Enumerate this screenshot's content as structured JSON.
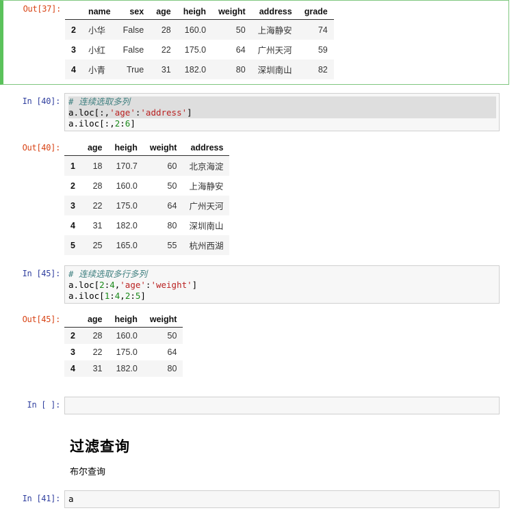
{
  "notebook": {
    "kernel_language": "python"
  },
  "cells": [
    {
      "id": "out37",
      "type": "output",
      "selected": true,
      "prompt": "Out[37]:",
      "table": {
        "index_name": "",
        "columns": [
          "name",
          "sex",
          "age",
          "heigh",
          "weight",
          "address",
          "grade"
        ],
        "index": [
          "2",
          "3",
          "4"
        ],
        "rows": [
          [
            "小华",
            "False",
            "28",
            "160.0",
            "50",
            "上海静安",
            "74"
          ],
          [
            "小红",
            "False",
            "22",
            "175.0",
            "64",
            "广州天河",
            "59"
          ],
          [
            "小青",
            "True",
            "31",
            "182.0",
            "80",
            "深圳南山",
            "82"
          ]
        ],
        "text_columns": [
          0,
          5
        ]
      }
    },
    {
      "id": "in40",
      "type": "input",
      "prompt": "In [40]:",
      "lines": [
        {
          "selected": true,
          "tokens": [
            {
              "t": "comment",
              "v": "# 连续选取多列"
            }
          ]
        },
        {
          "selected": true,
          "tokens": [
            {
              "t": "plain",
              "v": "a.loc[:,"
            },
            {
              "t": "str",
              "v": "'age'"
            },
            {
              "t": "plain",
              "v": ":"
            },
            {
              "t": "str",
              "v": "'address'"
            },
            {
              "t": "plain",
              "v": "]"
            }
          ]
        },
        {
          "selected": false,
          "tokens": [
            {
              "t": "plain",
              "v": "a.iloc[:,"
            },
            {
              "t": "num",
              "v": "2"
            },
            {
              "t": "plain",
              "v": ":"
            },
            {
              "t": "num",
              "v": "6"
            },
            {
              "t": "plain",
              "v": "]"
            }
          ]
        }
      ]
    },
    {
      "id": "out40",
      "type": "output",
      "prompt": "Out[40]:",
      "table": {
        "index_name": "",
        "columns": [
          "age",
          "heigh",
          "weight",
          "address"
        ],
        "index": [
          "1",
          "2",
          "3",
          "4",
          "5"
        ],
        "rows": [
          [
            "18",
            "170.7",
            "60",
            "北京海淀"
          ],
          [
            "28",
            "160.0",
            "50",
            "上海静安"
          ],
          [
            "22",
            "175.0",
            "64",
            "广州天河"
          ],
          [
            "31",
            "182.0",
            "80",
            "深圳南山"
          ],
          [
            "25",
            "165.0",
            "55",
            "杭州西湖"
          ]
        ],
        "text_columns": [
          3
        ]
      }
    },
    {
      "id": "in45",
      "type": "input",
      "prompt": "In [45]:",
      "lines": [
        {
          "selected": false,
          "tokens": [
            {
              "t": "comment",
              "v": "# 连续选取多行多列"
            }
          ]
        },
        {
          "selected": false,
          "tokens": [
            {
              "t": "plain",
              "v": "a.loc["
            },
            {
              "t": "num",
              "v": "2"
            },
            {
              "t": "plain",
              "v": ":"
            },
            {
              "t": "num",
              "v": "4"
            },
            {
              "t": "plain",
              "v": ","
            },
            {
              "t": "str",
              "v": "'age'"
            },
            {
              "t": "plain",
              "v": ":"
            },
            {
              "t": "str",
              "v": "'weight'"
            },
            {
              "t": "plain",
              "v": "]"
            }
          ]
        },
        {
          "selected": false,
          "tokens": [
            {
              "t": "plain",
              "v": "a.iloc["
            },
            {
              "t": "num",
              "v": "1"
            },
            {
              "t": "plain",
              "v": ":"
            },
            {
              "t": "num",
              "v": "4"
            },
            {
              "t": "plain",
              "v": ","
            },
            {
              "t": "num",
              "v": "2"
            },
            {
              "t": "plain",
              "v": ":"
            },
            {
              "t": "num",
              "v": "5"
            },
            {
              "t": "plain",
              "v": "]"
            }
          ]
        }
      ]
    },
    {
      "id": "out45",
      "type": "output",
      "prompt": "Out[45]:",
      "table": {
        "index_name": "",
        "columns": [
          "age",
          "heigh",
          "weight"
        ],
        "index": [
          "2",
          "3",
          "4"
        ],
        "rows": [
          [
            "28",
            "160.0",
            "50"
          ],
          [
            "22",
            "175.0",
            "64"
          ],
          [
            "31",
            "182.0",
            "80"
          ]
        ],
        "text_columns": []
      }
    },
    {
      "id": "in-empty",
      "type": "input",
      "prompt": "In [ ]:",
      "lines": [
        {
          "selected": false,
          "tokens": [
            {
              "t": "plain",
              "v": ""
            }
          ]
        }
      ]
    },
    {
      "id": "md1",
      "type": "markdown",
      "heading": "过滤查询",
      "paragraph": "布尔查询"
    },
    {
      "id": "in41",
      "type": "input",
      "prompt": "In [41]:",
      "lines": [
        {
          "selected": false,
          "tokens": [
            {
              "t": "plain",
              "v": "a"
            }
          ]
        }
      ]
    }
  ],
  "colors": {
    "selected_cell_border": "#7ec67e",
    "selected_cell_bar": "#5bc25b",
    "input_prompt": "#303F9F",
    "output_prompt": "#D84315",
    "code_background": "#f7f7f7",
    "code_border": "#cfcfcf",
    "text_selection": "#dedede",
    "comment": "#408080",
    "string": "#BA2121",
    "number": "#1a8a1a",
    "table_stripe": "#f5f5f5"
  }
}
